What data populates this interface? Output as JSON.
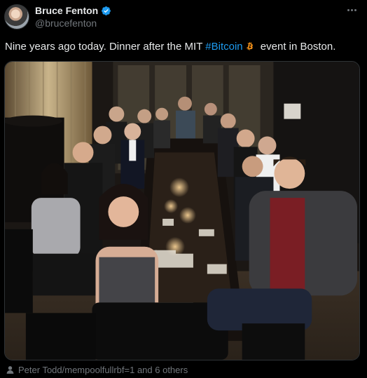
{
  "author": {
    "display_name": "Bruce Fenton",
    "handle": "@brucefenton",
    "verified": true
  },
  "tweet": {
    "text_before": "Nine years ago today.  Dinner after the MIT ",
    "hashtag": "#Bitcoin",
    "emoji_icon": "bitcoin-icon",
    "text_after": " event in Boston."
  },
  "photo": {
    "description_icon": "group-dinner-photo"
  },
  "tagged": {
    "text": "Peter Todd/mempoolfullrbf=1 and 6 others"
  },
  "colors": {
    "background": "#000000",
    "text": "#e7e9ea",
    "secondary": "#71767b",
    "accent": "#1d9bf0",
    "bitcoin": "#f7931a"
  }
}
